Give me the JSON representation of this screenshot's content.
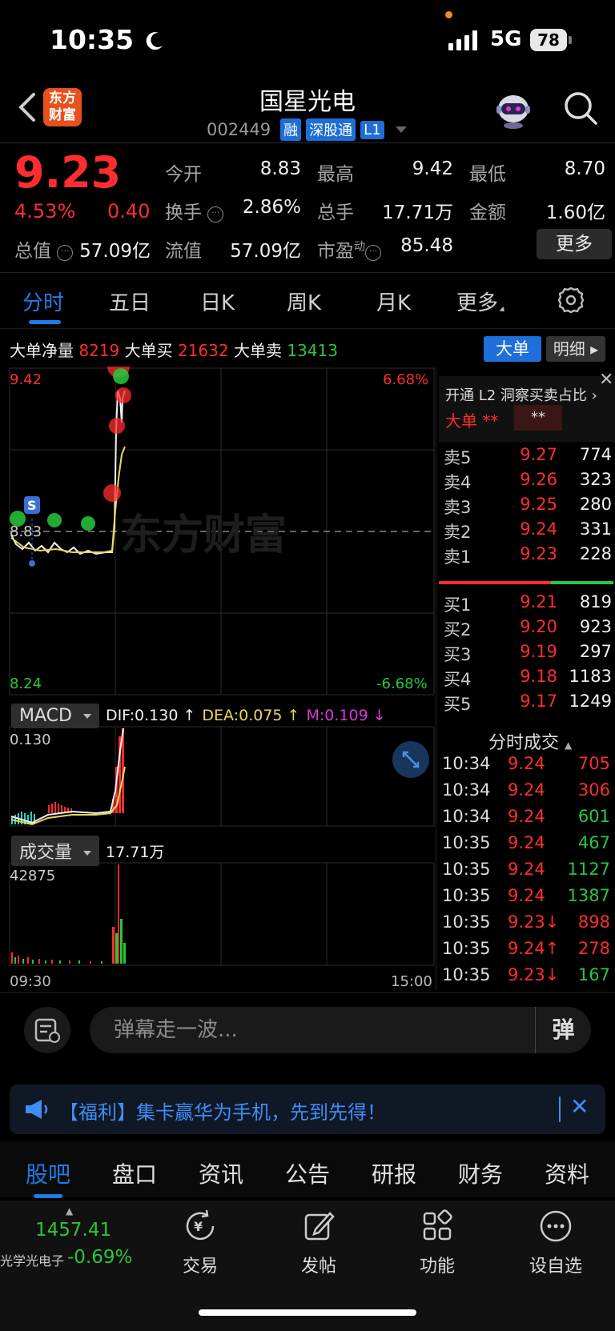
{
  "status": {
    "time": "10:35",
    "network": "5G",
    "battery": "78"
  },
  "header": {
    "title": "国星光电",
    "code": "002449",
    "logo_text": "东方财富",
    "tags": [
      "融",
      "深股通",
      "L1"
    ]
  },
  "quote": {
    "price": "9.23",
    "pct": "4.53%",
    "change": "0.40",
    "rows": [
      [
        {
          "label": "今开",
          "value": "8.83",
          "color": "white"
        },
        {
          "label": "最高",
          "value": "9.42",
          "color": "red"
        },
        {
          "label": "最低",
          "value": "8.70",
          "color": "green"
        }
      ],
      [
        {
          "label": "换手",
          "value": "2.86%",
          "color": "white"
        },
        {
          "label": "总手",
          "value": "17.71万",
          "color": "white"
        },
        {
          "label": "金额",
          "value": "1.60亿",
          "color": "white"
        }
      ],
      [
        {
          "label": "总值",
          "value": "57.09亿",
          "color": "white"
        },
        {
          "label": "流值",
          "value": "57.09亿",
          "color": "white"
        },
        {
          "label": "市盈",
          "label_sup": "动",
          "value": "85.48",
          "color": "white"
        }
      ]
    ],
    "more_label": "更多"
  },
  "period_tabs": [
    "分时",
    "五日",
    "日K",
    "周K",
    "月K",
    "更多"
  ],
  "big_order": {
    "net_label": "大单净量",
    "net": "8219",
    "buy_label": "大单买",
    "buy": "21632",
    "sell_label": "大单卖",
    "sell": "13413",
    "btn_big": "大单",
    "btn_detail": "明细"
  },
  "chart": {
    "price_high": "9.42",
    "price_low": "8.24",
    "pct_high": "6.68%",
    "pct_low": "-6.68%",
    "prev_close": "8.83",
    "watermark": "东方财富",
    "s_marker": "S",
    "macd": {
      "label": "MACD",
      "dif": "DIF:0.130 ↑",
      "dea": "DEA:0.075 ↑",
      "m": "M:0.109 ↓",
      "top": "0.130"
    },
    "volume": {
      "label": "成交量",
      "total": "17.71万",
      "top": "42875",
      "time_start": "09:30",
      "time_end": "15:00"
    }
  },
  "chart_data": {
    "type": "line",
    "series": [],
    "ylim": [
      8.24,
      9.42
    ],
    "note_prev_close": 8.83
  },
  "side": {
    "l2_text": "开通 L2 洞察买卖占比",
    "l2_big": "大单",
    "l2_mask1": "**",
    "l2_mask2": "**",
    "asks": [
      {
        "label": "卖5",
        "price": "9.27",
        "vol": "774"
      },
      {
        "label": "卖4",
        "price": "9.26",
        "vol": "323"
      },
      {
        "label": "卖3",
        "price": "9.25",
        "vol": "280"
      },
      {
        "label": "卖2",
        "price": "9.24",
        "vol": "331"
      },
      {
        "label": "卖1",
        "price": "9.23",
        "vol": "228"
      }
    ],
    "bids": [
      {
        "label": "买1",
        "price": "9.21",
        "vol": "819"
      },
      {
        "label": "买2",
        "price": "9.20",
        "vol": "923"
      },
      {
        "label": "买3",
        "price": "9.19",
        "vol": "297"
      },
      {
        "label": "买4",
        "price": "9.18",
        "vol": "1183"
      },
      {
        "label": "买5",
        "price": "9.17",
        "vol": "1249"
      }
    ],
    "ticks_title": "分时成交",
    "ticks": [
      {
        "time": "10:34",
        "price": "9.24",
        "vol": "705",
        "color": "red"
      },
      {
        "time": "10:34",
        "price": "9.24",
        "vol": "306",
        "color": "red"
      },
      {
        "time": "10:34",
        "price": "9.24",
        "vol": "601",
        "color": "green"
      },
      {
        "time": "10:35",
        "price": "9.24",
        "vol": "467",
        "color": "green"
      },
      {
        "time": "10:35",
        "price": "9.24",
        "vol": "1127",
        "color": "green"
      },
      {
        "time": "10:35",
        "price": "9.24",
        "vol": "1387",
        "color": "green"
      },
      {
        "time": "10:35",
        "price": "9.23↓",
        "vol": "898",
        "color": "red"
      },
      {
        "time": "10:35",
        "price": "9.24↑",
        "vol": "278",
        "color": "red"
      },
      {
        "time": "10:35",
        "price": "9.23↓",
        "vol": "167",
        "color": "green"
      }
    ]
  },
  "danmaku": {
    "placeholder": "弹幕走一波...",
    "send": "弹"
  },
  "promo": {
    "text": "【福利】集卡赢华为手机，先到先得！"
  },
  "bottom_tabs": [
    "股吧",
    "盘口",
    "资讯",
    "公告",
    "研报",
    "财务",
    "资料"
  ],
  "nav": {
    "index_value": "1457.41",
    "index_name": "光学光电子",
    "index_pct": "-0.69%",
    "items": [
      "交易",
      "发帖",
      "功能",
      "设自选"
    ]
  },
  "colors": {
    "up": "#ff2d2d",
    "down": "#28c83a",
    "accent": "#1e7ce8"
  }
}
